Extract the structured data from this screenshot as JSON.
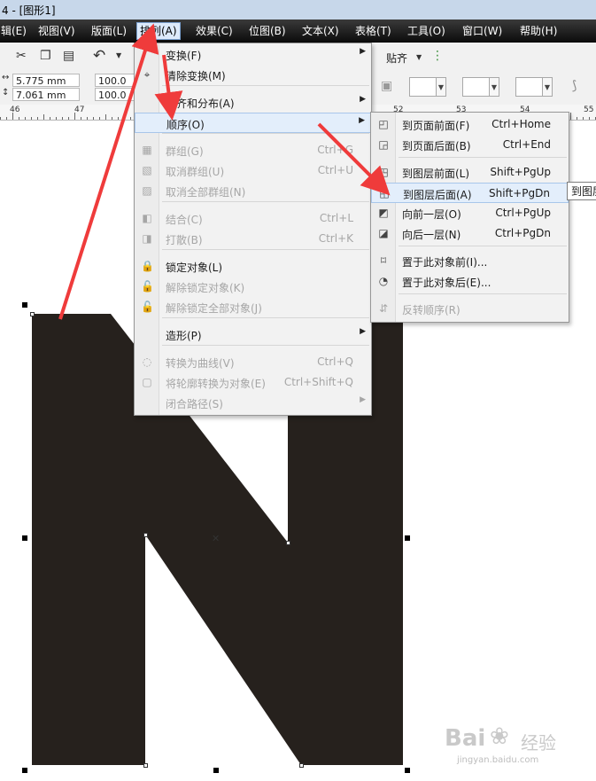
{
  "window": {
    "title": "4 - [图形1]"
  },
  "menubar": {
    "items": [
      {
        "label": "编辑(E)",
        "shown": "辑(E)"
      },
      {
        "label": "视图(V)"
      },
      {
        "label": "版面(L)"
      },
      {
        "label": "排列(A)"
      },
      {
        "label": "效果(C)"
      },
      {
        "label": "位图(B)"
      },
      {
        "label": "文本(X)"
      },
      {
        "label": "表格(T)"
      },
      {
        "label": "工具(O)"
      },
      {
        "label": "窗口(W)"
      },
      {
        "label": "帮助(H)"
      }
    ]
  },
  "toolbar": {
    "snap_label": "贴齐"
  },
  "propbar": {
    "width_value": "5.775 mm",
    "height_value": "7.061 mm",
    "scale_x": "100.0",
    "scale_y": "100.0"
  },
  "ruler": {
    "labels": [
      "46",
      "47",
      "52",
      "53",
      "54",
      "55"
    ]
  },
  "arrange_menu": {
    "items": [
      {
        "label": "变换(F)",
        "shortcut": "",
        "submenu": true,
        "enabled": true,
        "icon": ""
      },
      {
        "label": "清除变换(M)",
        "shortcut": "",
        "submenu": false,
        "enabled": true,
        "icon": "clear-transform-icon"
      },
      {
        "label": "对齐和分布(A)",
        "shortcut": "",
        "submenu": true,
        "enabled": true,
        "icon": ""
      },
      {
        "label": "顺序(O)",
        "shortcut": "",
        "submenu": true,
        "enabled": true,
        "icon": ""
      },
      {
        "label": "群组(G)",
        "shortcut": "Ctrl+G",
        "submenu": false,
        "enabled": false,
        "icon": "group-icon"
      },
      {
        "label": "取消群组(U)",
        "shortcut": "Ctrl+U",
        "submenu": false,
        "enabled": false,
        "icon": "ungroup-icon"
      },
      {
        "label": "取消全部群组(N)",
        "shortcut": "",
        "submenu": false,
        "enabled": false,
        "icon": "ungroup-all-icon"
      },
      {
        "label": "结合(C)",
        "shortcut": "Ctrl+L",
        "submenu": false,
        "enabled": false,
        "icon": "combine-icon"
      },
      {
        "label": "打散(B)",
        "shortcut": "Ctrl+K",
        "submenu": false,
        "enabled": false,
        "icon": "break-apart-icon"
      },
      {
        "label": "锁定对象(L)",
        "shortcut": "",
        "submenu": false,
        "enabled": true,
        "icon": "lock-icon"
      },
      {
        "label": "解除锁定对象(K)",
        "shortcut": "",
        "submenu": false,
        "enabled": false,
        "icon": "unlock-icon"
      },
      {
        "label": "解除锁定全部对象(J)",
        "shortcut": "",
        "submenu": false,
        "enabled": false,
        "icon": "unlock-all-icon"
      },
      {
        "label": "造形(P)",
        "shortcut": "",
        "submenu": true,
        "enabled": true,
        "icon": ""
      },
      {
        "label": "转换为曲线(V)",
        "shortcut": "Ctrl+Q",
        "submenu": false,
        "enabled": false,
        "icon": "convert-curves-icon"
      },
      {
        "label": "将轮廓转换为对象(E)",
        "shortcut": "Ctrl+Shift+Q",
        "submenu": false,
        "enabled": false,
        "icon": "outline-to-object-icon"
      },
      {
        "label": "闭合路径(S)",
        "shortcut": "",
        "submenu": true,
        "enabled": false,
        "icon": ""
      }
    ]
  },
  "order_submenu": {
    "items": [
      {
        "label": "到页面前面(F)",
        "shortcut": "Ctrl+Home",
        "enabled": true,
        "icon": "to-page-front-icon"
      },
      {
        "label": "到页面后面(B)",
        "shortcut": "Ctrl+End",
        "enabled": true,
        "icon": "to-page-back-icon"
      },
      {
        "label": "到图层前面(L)",
        "shortcut": "Shift+PgUp",
        "enabled": true,
        "icon": "to-layer-front-icon"
      },
      {
        "label": "到图层后面(A)",
        "shortcut": "Shift+PgDn",
        "enabled": true,
        "icon": "to-layer-back-icon"
      },
      {
        "label": "向前一层(O)",
        "shortcut": "Ctrl+PgUp",
        "enabled": true,
        "icon": "forward-one-icon"
      },
      {
        "label": "向后一层(N)",
        "shortcut": "Ctrl+PgDn",
        "enabled": true,
        "icon": "back-one-icon"
      },
      {
        "label": "置于此对象前(I)...",
        "shortcut": "",
        "enabled": true,
        "icon": "in-front-of-icon"
      },
      {
        "label": "置于此对象后(E)...",
        "shortcut": "",
        "enabled": true,
        "icon": "behind-icon"
      },
      {
        "label": "反转顺序(R)",
        "shortcut": "",
        "enabled": false,
        "icon": "reverse-order-icon"
      }
    ]
  },
  "tooltip": {
    "text": "到图层后面"
  },
  "watermark": {
    "brand": "Bai",
    "brand_cn": "经验",
    "url": "jingyan.baidu.com"
  },
  "colors": {
    "shape_fill": "#26211d",
    "arrow": "#ef3b3b",
    "menubar": "#1a1a1a",
    "highlight": "#e3eefb"
  }
}
